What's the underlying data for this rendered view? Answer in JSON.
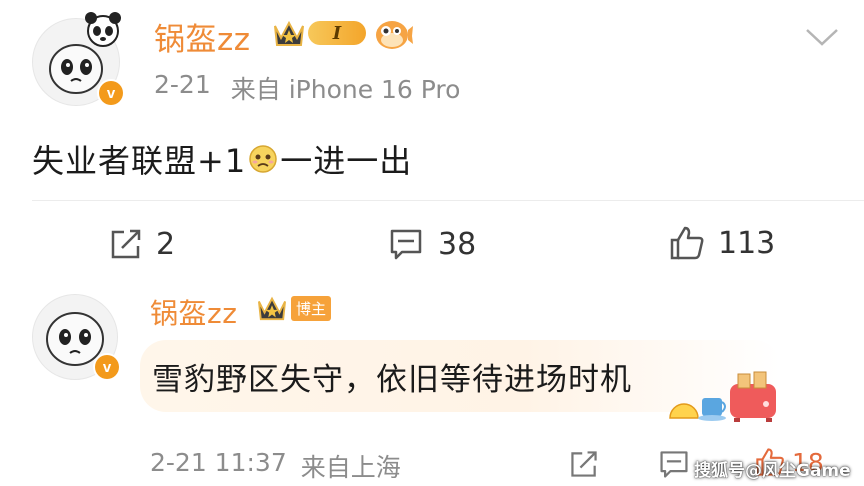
{
  "post": {
    "author": "锅盔zz",
    "level": "I",
    "date": "2-21",
    "source": "来自 iPhone 16 Pro",
    "content_before": "失业者联盟+1",
    "content_after": "一进一出",
    "emoji": "sad-face",
    "actions": {
      "repost_count": "2",
      "comment_count": "38",
      "like_count": "113"
    }
  },
  "reply": {
    "author": "锅盔zz",
    "badge": "博主",
    "content": "雪豹野区失守，依旧等待进场时机",
    "time": "2-21 11:37",
    "source": "来自上海",
    "like_count": "18"
  },
  "watermark": "搜狐号@风尘Game",
  "colors": {
    "username": "#ef8b37",
    "meta": "#8c8c8c",
    "verified_badge": "#f39a1b",
    "boss_tag": "#f6a23a",
    "like_icon_reply": "#e46a3c"
  }
}
